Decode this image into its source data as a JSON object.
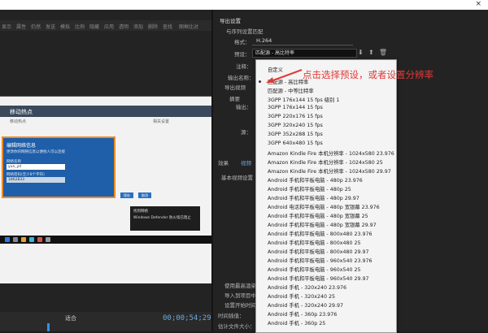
{
  "window": {
    "close_glyph": "×"
  },
  "left": {
    "toolbar_items": [
      "显示",
      "属性",
      "仍然",
      "发送",
      "模拟",
      "比例",
      "隐藏",
      "应用",
      "透明",
      "添加",
      "删除",
      "查找",
      "图框比对"
    ],
    "preview": {
      "title": "移动热点",
      "subtitle": "移动热点",
      "side_text": "相关设置",
      "dialog": {
        "title": "编辑网络信息",
        "text": "更改你的网络信息以便他人可以连接",
        "label1": "网络名称",
        "value1": "yun_yd",
        "label2": "网络密码(至少8个字符)",
        "value2": "1862833",
        "btn_save": "保存",
        "btn_cancel": "取消"
      },
      "toast_title": "找到网络",
      "toast_text": "Windows Defender 防火墙已阻止"
    },
    "timeline": {
      "fit_label": "适合",
      "timecode": "00;00;54;29"
    }
  },
  "right": {
    "export_section": "导出设置",
    "match_sequence": "与序列设置匹配",
    "format_label": "格式：",
    "format_value": "H.264",
    "preset_label": "预设：",
    "preset_value": "匹配源 - 高比特率",
    "comment_label": "注释：",
    "output_label": "输出名称：",
    "export_video": "导出视频",
    "summary_label": "摘要",
    "output_short": "输出：",
    "source_short": "源：",
    "tab_effects": "效果",
    "tab_video": "视频",
    "basic_video": "基本视频设置",
    "bottom_items": [
      "使用最高渲染质量",
      "导入到项目中",
      "设置开始时间",
      "时间插值：",
      "估计文件大小："
    ]
  },
  "dropdown": {
    "items": [
      "自定义",
      "匹配源 - 高比特率",
      "匹配源 - 中等比特率",
      "3GPP 176x144 15 fps 级别 1",
      "3GPP 176x144 15 fps",
      "3GPP 220x176 15 fps",
      "3GPP 320x240 15 fps",
      "3GPP 352x288 15 fps",
      "3GPP 640x480 15 fps",
      "Amazon Kindle Fire 本机分辨率 - 1024x580 23.976",
      "Amazon Kindle Fire 本机分辨率 - 1024x580 25",
      "Amazon Kindle Fire 本机分辨率 - 1024x580 29.97",
      "Android 手机和平板电脑 - 480p 23.976",
      "Android 手机和平板电脑 - 480p 25",
      "Android 手机和平板电脑 - 480p 29.97",
      "Android 电话和平板电脑 - 480p 宽银幕 23.976",
      "Android 手机和平板电脑 - 480p 宽银幕 25",
      "Android 手机和平板电脑 - 480p 宽银幕 29.97",
      "Android 手机和平板电脑 - 800x480 23.976",
      "Android 手机和平板电脑 - 800x480 25",
      "Android 手机和平板电脑 - 800x480 29.97",
      "Android 手机和平板电脑 - 960x540 23.976",
      "Android 手机和平板电脑 - 960x540 25",
      "Android 手机和平板电脑 - 960x540 29.97",
      "Android 手机 - 320x240 23.976",
      "Android 手机 - 320x240 25",
      "Android 手机 - 320x240 29.97",
      "Android 手机 - 360p 23.976",
      "Android 手机 - 360p 25"
    ],
    "selected_index": 1,
    "annotation": "点击选择预设，或者设置分辨率",
    "annotation_color": "#e23a3a"
  }
}
